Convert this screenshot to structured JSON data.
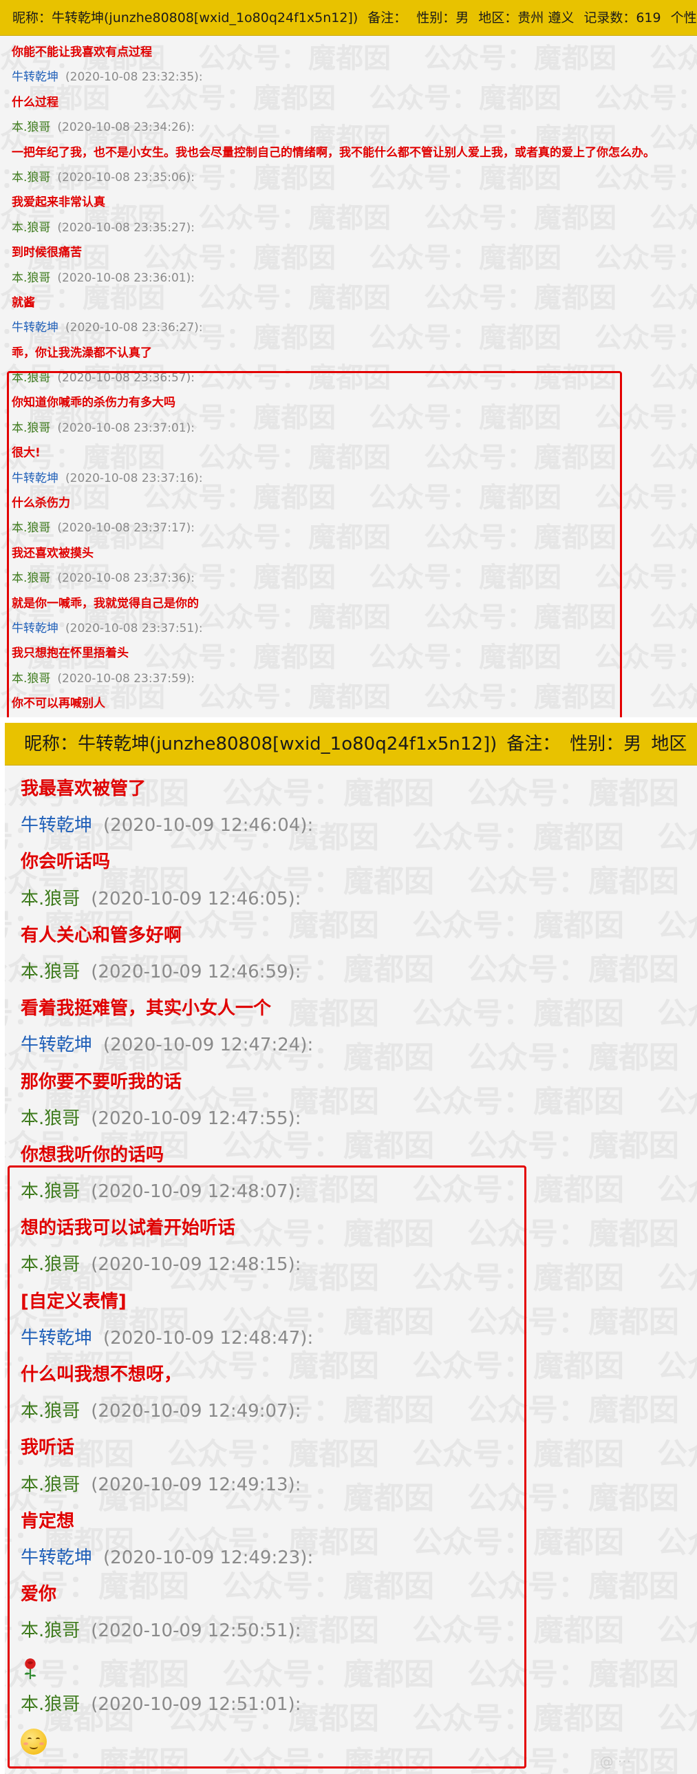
{
  "watermark": "公众号：魔都囡",
  "panel1": {
    "header": [
      "昵称：牛转乾坤(junzhe80808[wxid_1o80q24f1x5n12])",
      "备注：",
      "性别：男",
      "地区：贵州 遵义",
      "记录数：619",
      "个性签名："
    ],
    "rows": [
      {
        "type": "msg",
        "text": "你能不能让我喜欢有点过程"
      },
      {
        "type": "meta",
        "sender": "牛转乾坤",
        "color": "blue",
        "time": "(2020-10-08 23:32:35):"
      },
      {
        "type": "msg",
        "text": "什么过程"
      },
      {
        "type": "meta",
        "sender": "本.狼哥",
        "color": "green",
        "time": "(2020-10-08 23:34:26):"
      },
      {
        "type": "msg",
        "text": "一把年纪了我，也不是小女生。我也会尽量控制自己的情绪啊，我不能什么都不管让别人爱上我，或者真的爱上了你怎么办。"
      },
      {
        "type": "meta",
        "sender": "本.狼哥",
        "color": "green",
        "time": "(2020-10-08 23:35:06):"
      },
      {
        "type": "msg",
        "text": "我爱起来非常认真"
      },
      {
        "type": "meta",
        "sender": "本.狼哥",
        "color": "green",
        "time": "(2020-10-08 23:35:27):"
      },
      {
        "type": "msg",
        "text": "到时候很痛苦"
      },
      {
        "type": "meta",
        "sender": "本.狼哥",
        "color": "green",
        "time": "(2020-10-08 23:36:01):"
      },
      {
        "type": "msg",
        "text": "就酱"
      },
      {
        "type": "meta",
        "sender": "牛转乾坤",
        "color": "blue",
        "time": "(2020-10-08 23:36:27):"
      },
      {
        "type": "msg",
        "text": "乖，你让我洗澡都不认真了"
      },
      {
        "type": "meta",
        "sender": "本.狼哥",
        "color": "green",
        "time": "(2020-10-08 23:36:57):"
      },
      {
        "type": "msg",
        "text": "你知道你喊乖的杀伤力有多大吗"
      },
      {
        "type": "meta",
        "sender": "本.狼哥",
        "color": "green",
        "time": "(2020-10-08 23:37:01):"
      },
      {
        "type": "msg",
        "text": "很大!"
      },
      {
        "type": "meta",
        "sender": "牛转乾坤",
        "color": "blue",
        "time": "(2020-10-08 23:37:16):"
      },
      {
        "type": "msg",
        "text": "什么杀伤力"
      },
      {
        "type": "meta",
        "sender": "本.狼哥",
        "color": "green",
        "time": "(2020-10-08 23:37:17):"
      },
      {
        "type": "msg",
        "text": "我还喜欢被摸头"
      },
      {
        "type": "meta",
        "sender": "本.狼哥",
        "color": "green",
        "time": "(2020-10-08 23:37:36):"
      },
      {
        "type": "msg",
        "text": "就是你一喊乖，我就觉得自己是你的"
      },
      {
        "type": "meta",
        "sender": "牛转乾坤",
        "color": "blue",
        "time": "(2020-10-08 23:37:51):"
      },
      {
        "type": "msg",
        "text": "我只想抱在怀里捂着头"
      },
      {
        "type": "meta",
        "sender": "本.狼哥",
        "color": "green",
        "time": "(2020-10-08 23:37:59):"
      },
      {
        "type": "msg",
        "text": "你不可以再喊别人"
      }
    ]
  },
  "panel2": {
    "header": [
      "昵称：牛转乾坤(junzhe80808[wxid_1o80q24f1x5n12])",
      "备注：",
      "性别：男",
      "地区"
    ],
    "rows": [
      {
        "type": "msg",
        "text": "我最喜欢被管了"
      },
      {
        "type": "meta",
        "sender": "牛转乾坤",
        "color": "blue",
        "time": "(2020-10-09 12:46:04):"
      },
      {
        "type": "msg",
        "text": "你会听话吗"
      },
      {
        "type": "meta",
        "sender": "本.狼哥",
        "color": "green",
        "time": "(2020-10-09 12:46:05):"
      },
      {
        "type": "msg",
        "text": "有人关心和管多好啊"
      },
      {
        "type": "meta",
        "sender": "本.狼哥",
        "color": "green",
        "time": "(2020-10-09 12:46:59):"
      },
      {
        "type": "msg",
        "text": "看着我挺难管，其实小女人一个"
      },
      {
        "type": "meta",
        "sender": "牛转乾坤",
        "color": "blue",
        "time": "(2020-10-09 12:47:24):"
      },
      {
        "type": "msg",
        "text": "那你要不要听我的话"
      },
      {
        "type": "meta",
        "sender": "本.狼哥",
        "color": "green",
        "time": "(2020-10-09 12:47:55):"
      },
      {
        "type": "msg",
        "text": "你想我听你的话吗"
      },
      {
        "type": "meta",
        "sender": "本.狼哥",
        "color": "green",
        "time": "(2020-10-09 12:48:07):"
      },
      {
        "type": "msg",
        "text": "想的话我可以试着开始听话"
      },
      {
        "type": "meta",
        "sender": "本.狼哥",
        "color": "green",
        "time": "(2020-10-09 12:48:15):"
      },
      {
        "type": "msg",
        "text": "[自定义表情]"
      },
      {
        "type": "meta",
        "sender": "牛转乾坤",
        "color": "blue",
        "time": "(2020-10-09 12:48:47):"
      },
      {
        "type": "msg",
        "text": "什么叫我想不想呀，"
      },
      {
        "type": "meta",
        "sender": "本.狼哥",
        "color": "green",
        "time": "(2020-10-09 12:49:07):"
      },
      {
        "type": "msg",
        "text": "我听话"
      },
      {
        "type": "meta",
        "sender": "本.狼哥",
        "color": "green",
        "time": "(2020-10-09 12:49:13):"
      },
      {
        "type": "msg",
        "text": "肯定想"
      },
      {
        "type": "meta",
        "sender": "牛转乾坤",
        "color": "blue",
        "time": "(2020-10-09 12:49:23):"
      },
      {
        "type": "msg",
        "text": "爱你"
      },
      {
        "type": "meta",
        "sender": "本.狼哥",
        "color": "green",
        "time": "(2020-10-09 12:50:51):"
      },
      {
        "type": "emoji",
        "icon": "rose-icon"
      },
      {
        "type": "meta",
        "sender": "本.狼哥",
        "color": "green",
        "time": "(2020-10-09 12:51:01):"
      },
      {
        "type": "emoji",
        "icon": "smile-face-icon"
      }
    ]
  },
  "colors": {
    "header_bg": "#e8c200",
    "message": "#e00000",
    "sender_blue": "#1f5fb8",
    "sender_green": "#3d7a1c",
    "highlight_border": "#e30000"
  }
}
